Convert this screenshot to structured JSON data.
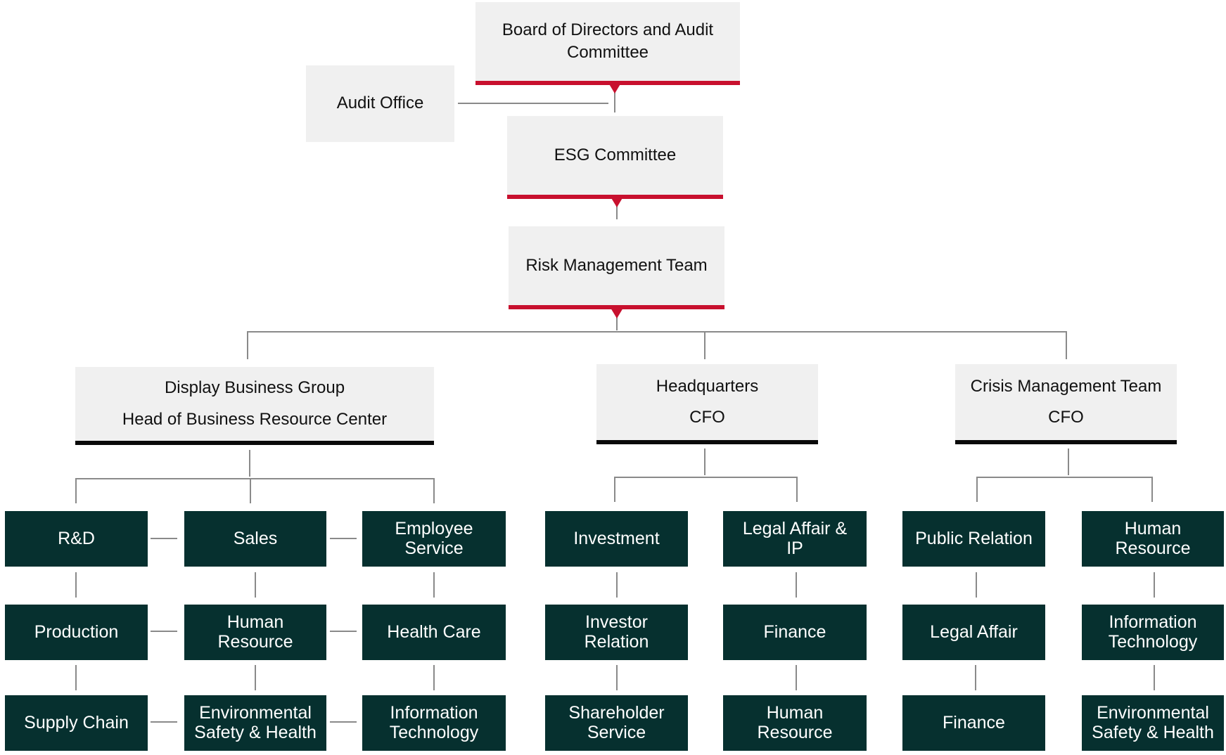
{
  "top": {
    "board": {
      "line1": "Board of Directors and Audit",
      "line2": "Committee"
    },
    "audit_office": "Audit Office",
    "esg_committee": "ESG Committee",
    "risk_team": "Risk Management Team"
  },
  "groups": {
    "display": {
      "line1": "Display Business Group",
      "line2": "Head of Business Resource Center"
    },
    "headquarters": {
      "line1": "Headquarters",
      "line2": "CFO"
    },
    "crisis": {
      "line1": "Crisis Management Team",
      "line2": "CFO"
    }
  },
  "display_units": {
    "rd": {
      "l1": "R&D",
      "l2": ""
    },
    "sales": {
      "l1": "Sales",
      "l2": ""
    },
    "employee_service": {
      "l1": "Employee",
      "l2": "Service"
    },
    "production": {
      "l1": "Production",
      "l2": ""
    },
    "human_resource": {
      "l1": "Human",
      "l2": "Resource"
    },
    "health_care": {
      "l1": "Health Care",
      "l2": ""
    },
    "supply_chain": {
      "l1": "Supply Chain",
      "l2": ""
    },
    "esh": {
      "l1": "Environmental",
      "l2": "Safety & Health"
    },
    "it": {
      "l1": "Information",
      "l2": "Technology"
    }
  },
  "hq_units": {
    "investment": {
      "l1": "Investment",
      "l2": ""
    },
    "legal_ip": {
      "l1": "Legal Affair &",
      "l2": "IP"
    },
    "investor_relation": {
      "l1": "Investor",
      "l2": "Relation"
    },
    "finance": {
      "l1": "Finance",
      "l2": ""
    },
    "shareholder_service": {
      "l1": "Shareholder",
      "l2": "Service"
    },
    "human_resource": {
      "l1": "Human",
      "l2": "Resource"
    }
  },
  "crisis_units": {
    "public_relation": {
      "l1": "Public Relation",
      "l2": ""
    },
    "human_resource": {
      "l1": "Human",
      "l2": "Resource"
    },
    "legal_affair": {
      "l1": "Legal Affair",
      "l2": ""
    },
    "it": {
      "l1": "Information",
      "l2": "Technology"
    },
    "finance": {
      "l1": "Finance",
      "l2": ""
    },
    "esh": {
      "l1": "Environmental",
      "l2": "Safety & Health"
    }
  },
  "colors": {
    "accent_red": "#c8102e",
    "node_dark": "#06302f",
    "node_light": "#f0f0f0",
    "connector": "#8a8a8a"
  }
}
